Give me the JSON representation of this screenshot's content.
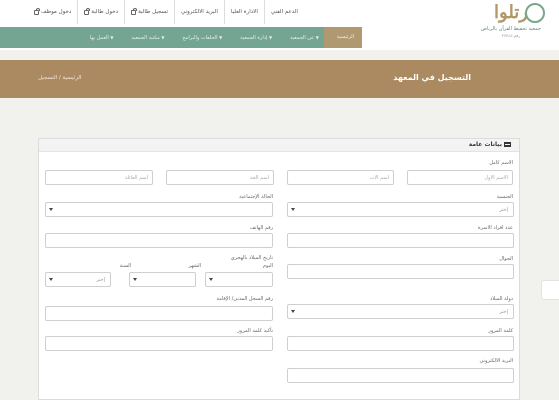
{
  "top_links": [
    {
      "label": "الدعم الفني",
      "lock": false
    },
    {
      "label": "الادارة العليا",
      "lock": false
    },
    {
      "label": "البريد الالكتروني",
      "lock": false
    },
    {
      "label": "تسجيل طالبة",
      "lock": true
    },
    {
      "label": "دخول طالبة",
      "lock": true
    },
    {
      "label": "دخول موظف",
      "lock": true
    }
  ],
  "logo": {
    "mark": "رتلوا",
    "name": "جمعية تحفيظ القرآن بالرياض",
    "sub": "رقم ٣٧٣٤٥"
  },
  "nav": {
    "items": [
      {
        "label": "الرئيسية",
        "caret": false,
        "active": true
      },
      {
        "label": "عن الجمعية",
        "caret": true
      },
      {
        "label": "إدارة الجمعية",
        "caret": true
      },
      {
        "label": "الحلقات والبرامج",
        "caret": true
      },
      {
        "label": "مكتبة الجمعية",
        "caret": true
      },
      {
        "label": "العمل بها",
        "caret": true
      }
    ]
  },
  "banner": {
    "title": "التسجيل في المعهد",
    "breadcrumb": "الرئيسية  /  التسجيل"
  },
  "card": {
    "title": "بيانات عامة"
  },
  "form": {
    "full_name_label": "الاسم كامل",
    "first_name_ph": "الاسم الأول",
    "father_name_ph": "اسم الأب",
    "grandfather_name_ph": "اسم الجد",
    "family_name_ph": "اسم العائلة",
    "nationality_label": "الجنسية",
    "nationality_value": "إختر",
    "marital_label": "الحالة الإجتماعية",
    "family_count_label": "عدد افراد الاسرة",
    "phone_label": "رقم الهاتف",
    "mobile_label": "الجوال",
    "hijri_dob_label": "تاريخ الميلاد بالهجري",
    "day_label": "اليوم",
    "month_label": "الشهر",
    "year_label": "السنة",
    "year_value": "إختر",
    "birth_country_label": "دولة الميلاد",
    "birth_country_value": "إختر",
    "civil_id_label": "رقم السجل المدني/ الإقامة",
    "password_label": "كلمة المرور",
    "confirm_password_label": "تأكيد كلمة المرور",
    "email_label": "البريد الالكتروني"
  }
}
